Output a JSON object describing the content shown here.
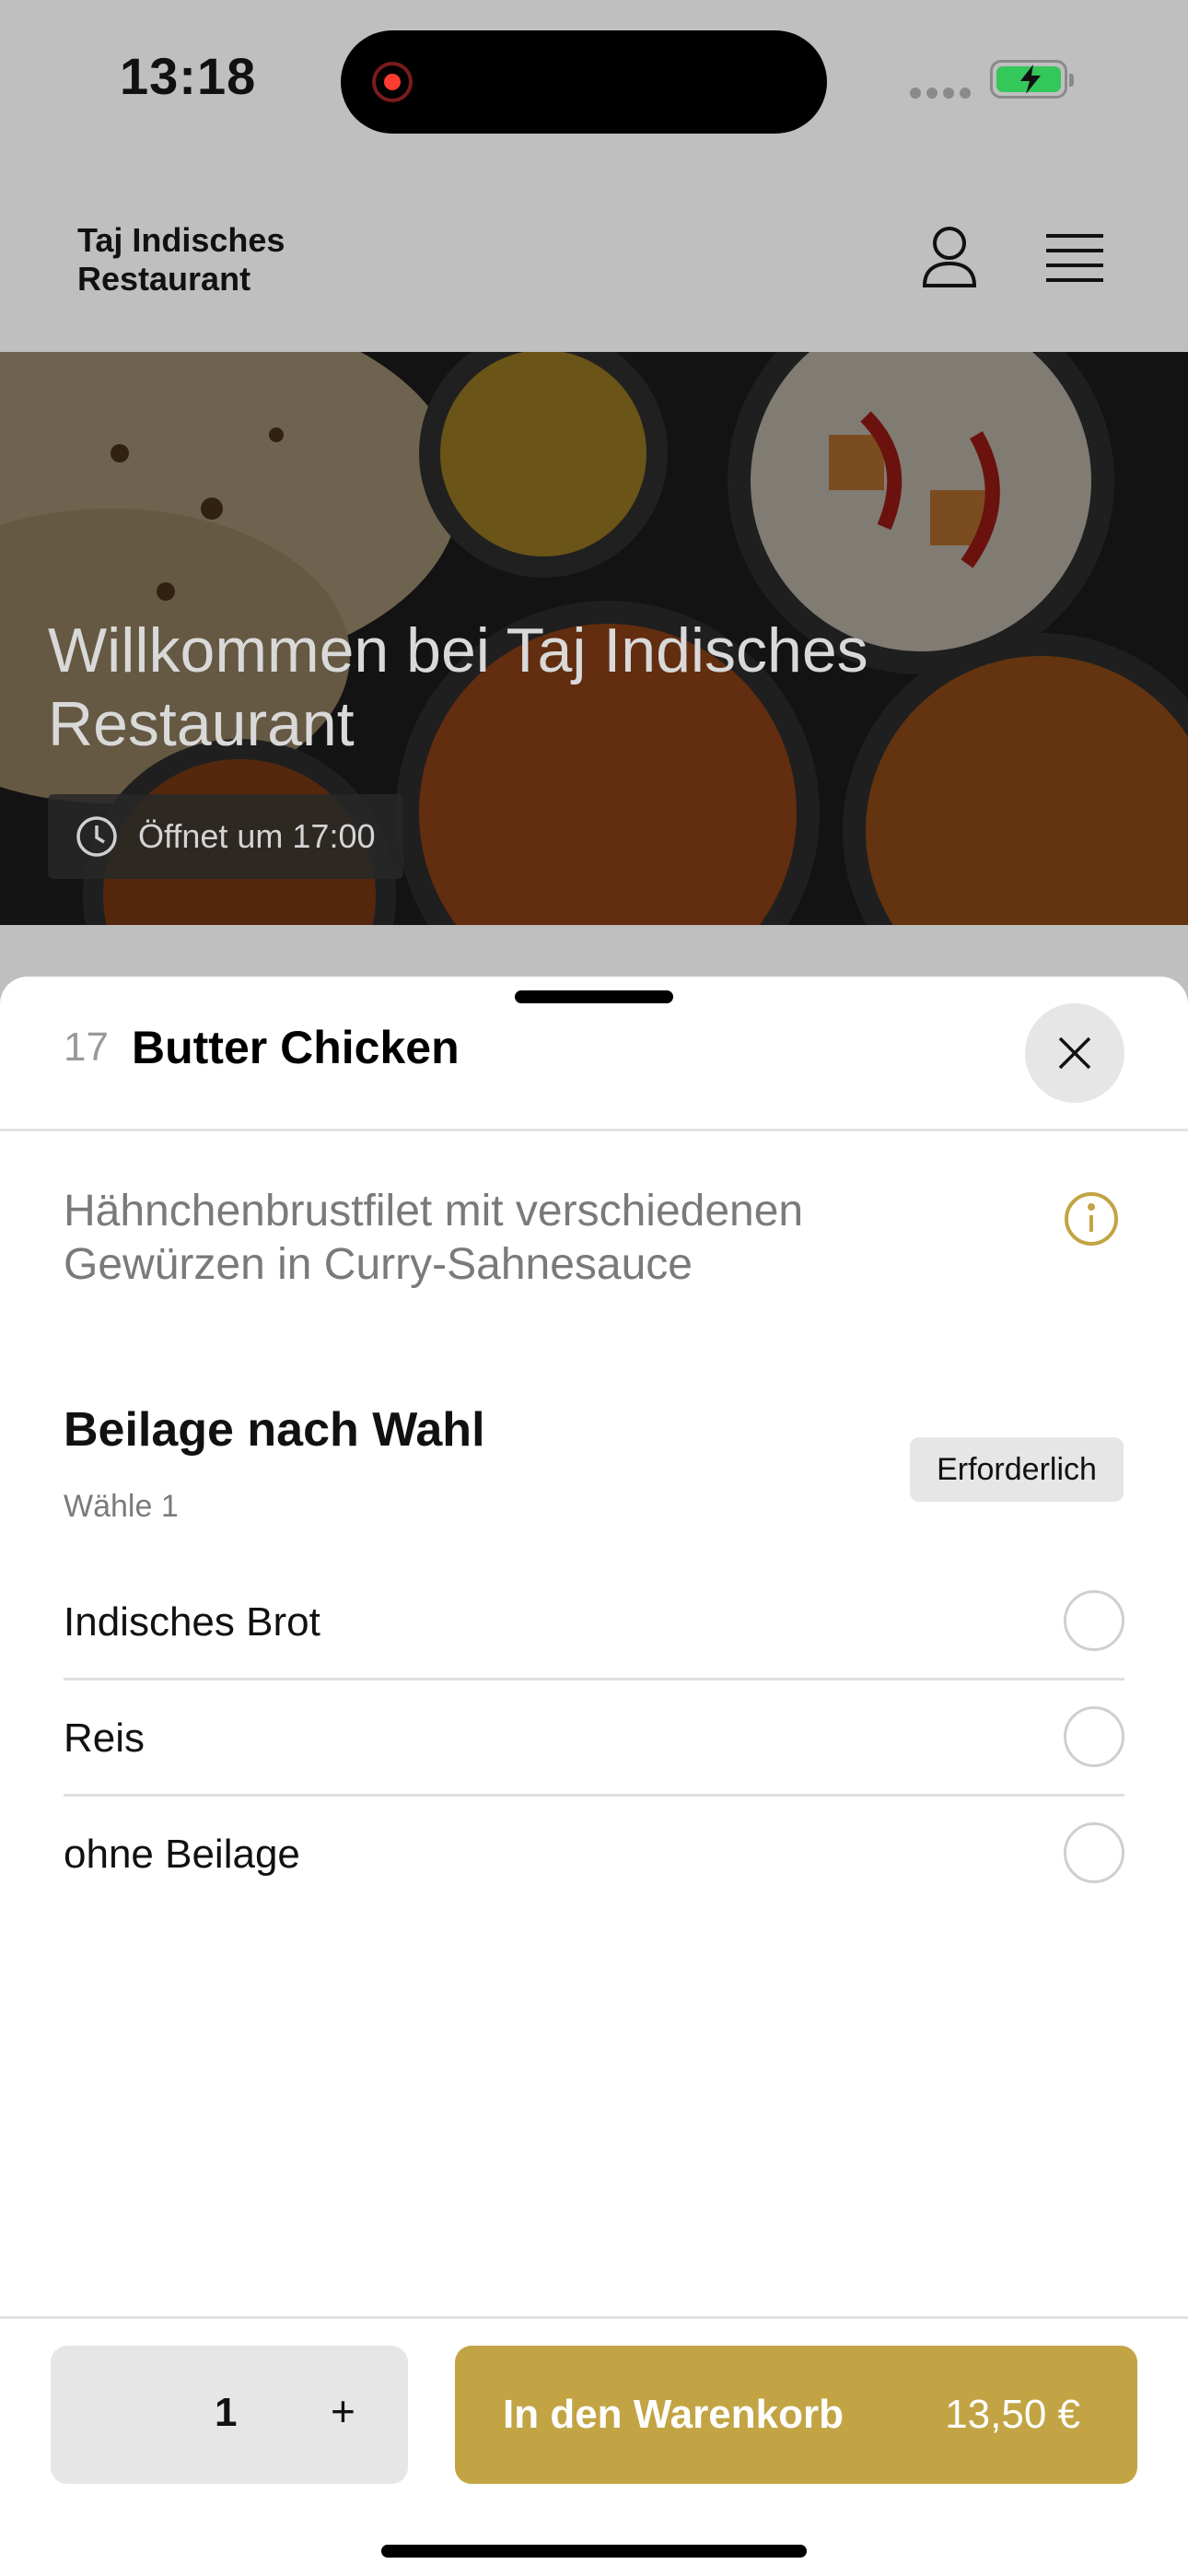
{
  "status_bar": {
    "time": "13:18"
  },
  "header": {
    "brand_line1": "Taj Indisches",
    "brand_line2": "Restaurant"
  },
  "hero": {
    "title": "Willkommen bei Taj Indisches Restaurant",
    "opening_status": "Öffnet um 17:00"
  },
  "item": {
    "number": "17",
    "name": "Butter Chicken",
    "description": "Hähnchenbrustfilet mit verschiedenen Gewürzen in Curry-Sahnesauce"
  },
  "option_group": {
    "title": "Beilage nach Wahl",
    "subtitle": "Wähle 1",
    "badge": "Erforderlich",
    "options": [
      {
        "label": "Indisches Brot",
        "selected": false
      },
      {
        "label": "Reis",
        "selected": false
      },
      {
        "label": "ohne Beilage",
        "selected": false
      }
    ]
  },
  "footer": {
    "quantity": "1",
    "plus_label": "+",
    "add_to_cart_label": "In den Warenkorb",
    "price": "13,50 €"
  },
  "colors": {
    "accent": "#c2a445",
    "dim_backdrop": "#bfbfbf"
  }
}
